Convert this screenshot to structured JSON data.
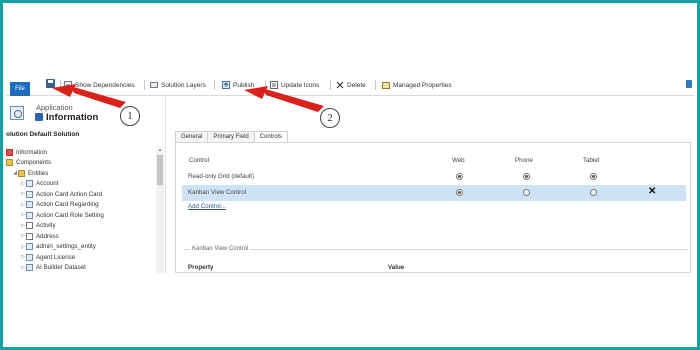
{
  "toolbar": {
    "file_label": "File",
    "items": [
      {
        "label": "Show Dependencies",
        "icon": "dependencies-icon"
      },
      {
        "label": "Solution Layers",
        "icon": "layers-icon"
      },
      {
        "label": "Publish",
        "icon": "publish-icon"
      },
      {
        "label": "Update Icons",
        "icon": "update-icons-icon"
      },
      {
        "label": "Delete",
        "icon": "delete-icon"
      },
      {
        "label": "Managed Properties",
        "icon": "managed-properties-icon"
      }
    ]
  },
  "sidebar": {
    "app_subtitle": "Application",
    "app_title": "Information",
    "solution_name": "olution Default Solution",
    "tree": [
      {
        "label": "Information",
        "level": 0,
        "icon": "warn"
      },
      {
        "label": "Components",
        "level": 0,
        "icon": "comp"
      },
      {
        "label": "Entities",
        "level": 1,
        "icon": "comp",
        "expanded": true
      },
      {
        "label": "Account",
        "level": 2
      },
      {
        "label": "Action Card Action Card",
        "level": 2
      },
      {
        "label": "Action Card Regarding",
        "level": 2
      },
      {
        "label": "Action Card Role Setting",
        "level": 2
      },
      {
        "label": "Activity",
        "level": 2,
        "icon": "doc"
      },
      {
        "label": "Address",
        "level": 2,
        "icon": "doc"
      },
      {
        "label": "admin_settings_entity",
        "level": 2
      },
      {
        "label": "Agent License",
        "level": 2
      },
      {
        "label": "AI Builder Dataset",
        "level": 2
      }
    ]
  },
  "tabs": [
    "General",
    "Primary Field",
    "Controls"
  ],
  "active_tab": "Controls",
  "controls_grid": {
    "headers": [
      "Control",
      "Web",
      "Phone",
      "Tablet"
    ],
    "rows": [
      {
        "label": "Read-only Grid (default)",
        "web": true,
        "phone": true,
        "tablet": true,
        "selected": false
      },
      {
        "label": "Kanban View Control",
        "web": true,
        "phone": false,
        "tablet": false,
        "selected": true
      }
    ],
    "delete_symbol": "✕",
    "add_control": "Add Control..."
  },
  "kanban_section": {
    "title": "Kanban View Control",
    "property_header": "Property",
    "value_header": "Value"
  },
  "annotations": {
    "badge_1": "1",
    "badge_2": "2",
    "arrow_color": "#d9221c"
  },
  "colors": {
    "frame": "#16a1a1",
    "file_button": "#1f6dc0",
    "selected_row": "#cfe3f7"
  }
}
